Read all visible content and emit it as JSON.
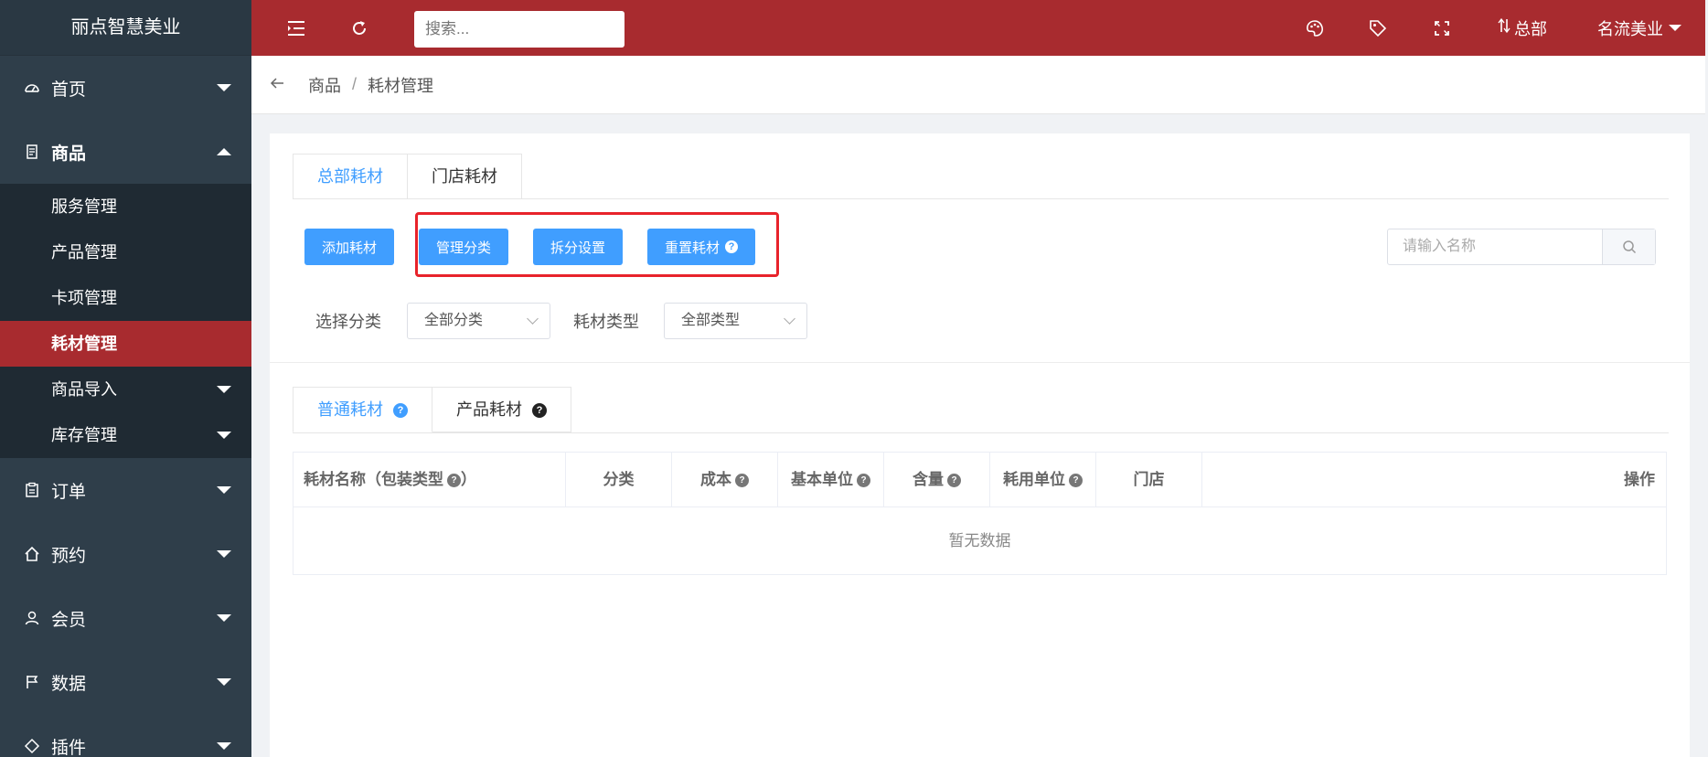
{
  "app": {
    "brand": "丽点智慧美业"
  },
  "sidebar": {
    "items": [
      {
        "label": "首页",
        "icon": "dashboard-icon"
      },
      {
        "label": "商品",
        "icon": "document-icon"
      },
      {
        "label": "订单",
        "icon": "clipboard-icon"
      },
      {
        "label": "预约",
        "icon": "home-icon"
      },
      {
        "label": "会员",
        "icon": "user-icon"
      },
      {
        "label": "数据",
        "icon": "flag-icon"
      },
      {
        "label": "插件",
        "icon": "plugin-icon"
      }
    ],
    "submenu": [
      {
        "label": "服务管理"
      },
      {
        "label": "产品管理"
      },
      {
        "label": "卡项管理"
      },
      {
        "label": "耗材管理",
        "active": true
      },
      {
        "label": "商品导入"
      },
      {
        "label": "库存管理"
      }
    ]
  },
  "topbar": {
    "search_placeholder": "搜索...",
    "hq_label": "总部",
    "store_label": "名流美业"
  },
  "breadcrumb": {
    "parent": "商品",
    "sep": "/",
    "current": "耗材管理"
  },
  "tabs": [
    "总部耗材",
    "门店耗材"
  ],
  "toolbar": {
    "add": "添加耗材",
    "manage_category": "管理分类",
    "split_settings": "拆分设置",
    "reset": "重置耗材",
    "name_placeholder": "请输入名称"
  },
  "filters": {
    "category_label": "选择分类",
    "category_value": "全部分类",
    "type_label": "耗材类型",
    "type_value": "全部类型"
  },
  "subtabs": [
    "普通耗材",
    "产品耗材"
  ],
  "table": {
    "columns": [
      "耗材名称（包装类型",
      "分类",
      "成本",
      "基本单位",
      "含量",
      "耗用单位",
      "门店",
      "操作"
    ],
    "name_suffix": "）",
    "empty": "暂无数据"
  },
  "colors": {
    "topbar": "#a82b2f",
    "sidebar": "#2f3e4a",
    "primary": "#409eff",
    "highlight": "#e8232b"
  }
}
